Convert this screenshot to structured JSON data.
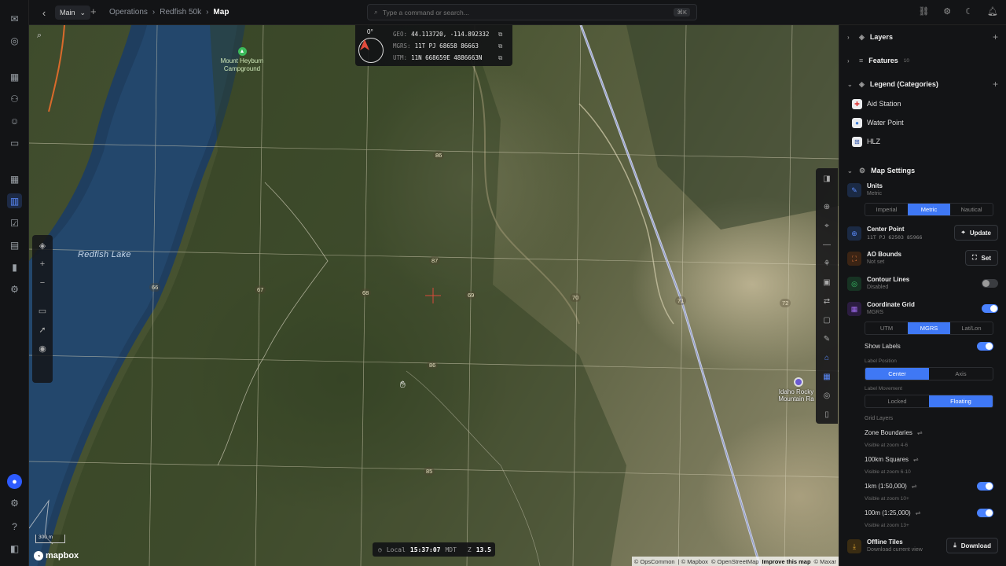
{
  "topbar": {
    "branch": "Main",
    "breadcrumb": [
      "Operations",
      "Redfish 50k",
      "Map"
    ],
    "command_placeholder": "Type a command or search...",
    "command_shortcut": "⌘K"
  },
  "map": {
    "lake_label": "Redfish Lake",
    "campground_label": "Mount Heyburn Campground",
    "poi_label": "Idaho Rocky Mountain Ra",
    "compass_heading": "0°",
    "geo": {
      "key": "GEO:",
      "value": "44.113720, -114.892332"
    },
    "mgrs": {
      "key": "MGRS:",
      "value": "11T PJ 68658 86663"
    },
    "utm": {
      "key": "UTM:",
      "value": "11N 668659E 4886663N"
    },
    "grid_labels": [
      "86",
      "87",
      "66",
      "67",
      "68",
      "69",
      "70",
      "71",
      "72",
      "86",
      "85"
    ],
    "time": {
      "label": "Local",
      "value": "15:37:07",
      "tz": "MDT",
      "zoom_label": "Z",
      "zoom": "13.5"
    },
    "scale": "300 m",
    "logo": "mapbox",
    "attribution": [
      "© OpsCommon",
      "| © Mapbox",
      "© OpenStreetMap",
      "Improve this map",
      "© Maxar"
    ]
  },
  "panel": {
    "layers": "Layers",
    "features": "Features",
    "features_count": "10",
    "legend_title": "Legend (Categories)",
    "legend": [
      {
        "label": "Aid Station",
        "icon": "plus-icon",
        "color": "#d33"
      },
      {
        "label": "Water Point",
        "icon": "drop-icon",
        "color": "#3a7bd5"
      },
      {
        "label": "HLZ",
        "icon": "hlz-icon",
        "color": "#2a4ea8"
      }
    ],
    "map_settings": "Map Settings",
    "units": {
      "title": "Units",
      "sub": "Metric",
      "options": [
        "Imperial",
        "Metric",
        "Nautical"
      ],
      "selected": 1
    },
    "center_point": {
      "title": "Center Point",
      "sub": "11T PJ 62503 85966",
      "button": "Update"
    },
    "ao_bounds": {
      "title": "AO Bounds",
      "sub": "Not set",
      "button": "Set"
    },
    "contour": {
      "title": "Contour Lines",
      "sub": "Disabled",
      "on": false
    },
    "coord_grid": {
      "title": "Coordinate Grid",
      "sub": "MGRS",
      "on": true,
      "options": [
        "UTM",
        "MGRS",
        "Lat/Lon"
      ],
      "selected": 1
    },
    "show_labels": {
      "label": "Show Labels",
      "on": true
    },
    "label_position": {
      "label": "Label Position",
      "options": [
        "Center",
        "Axis"
      ],
      "selected": 0
    },
    "label_movement": {
      "label": "Label Movement",
      "options": [
        "Locked",
        "Floating"
      ],
      "selected": 1
    },
    "grid_layers_title": "Grid Layers",
    "grid_layers": [
      {
        "name": "Zone Boundaries",
        "visible": "Visible at zoom 4-6",
        "toggle": false
      },
      {
        "name": "100km Squares",
        "visible": "Visible at zoom 6-10",
        "toggle": false
      },
      {
        "name": "1km (1:50,000)",
        "visible": "Visible at zoom 10+",
        "toggle": true
      },
      {
        "name": "100m (1:25,000)",
        "visible": "Visible at zoom 13+",
        "toggle": true
      }
    ],
    "offline": {
      "title": "Offline Tiles",
      "sub": "Download current view",
      "button": "Download"
    }
  },
  "colors": {
    "accent": "#3f78f5",
    "panel_bg": "#131416"
  }
}
